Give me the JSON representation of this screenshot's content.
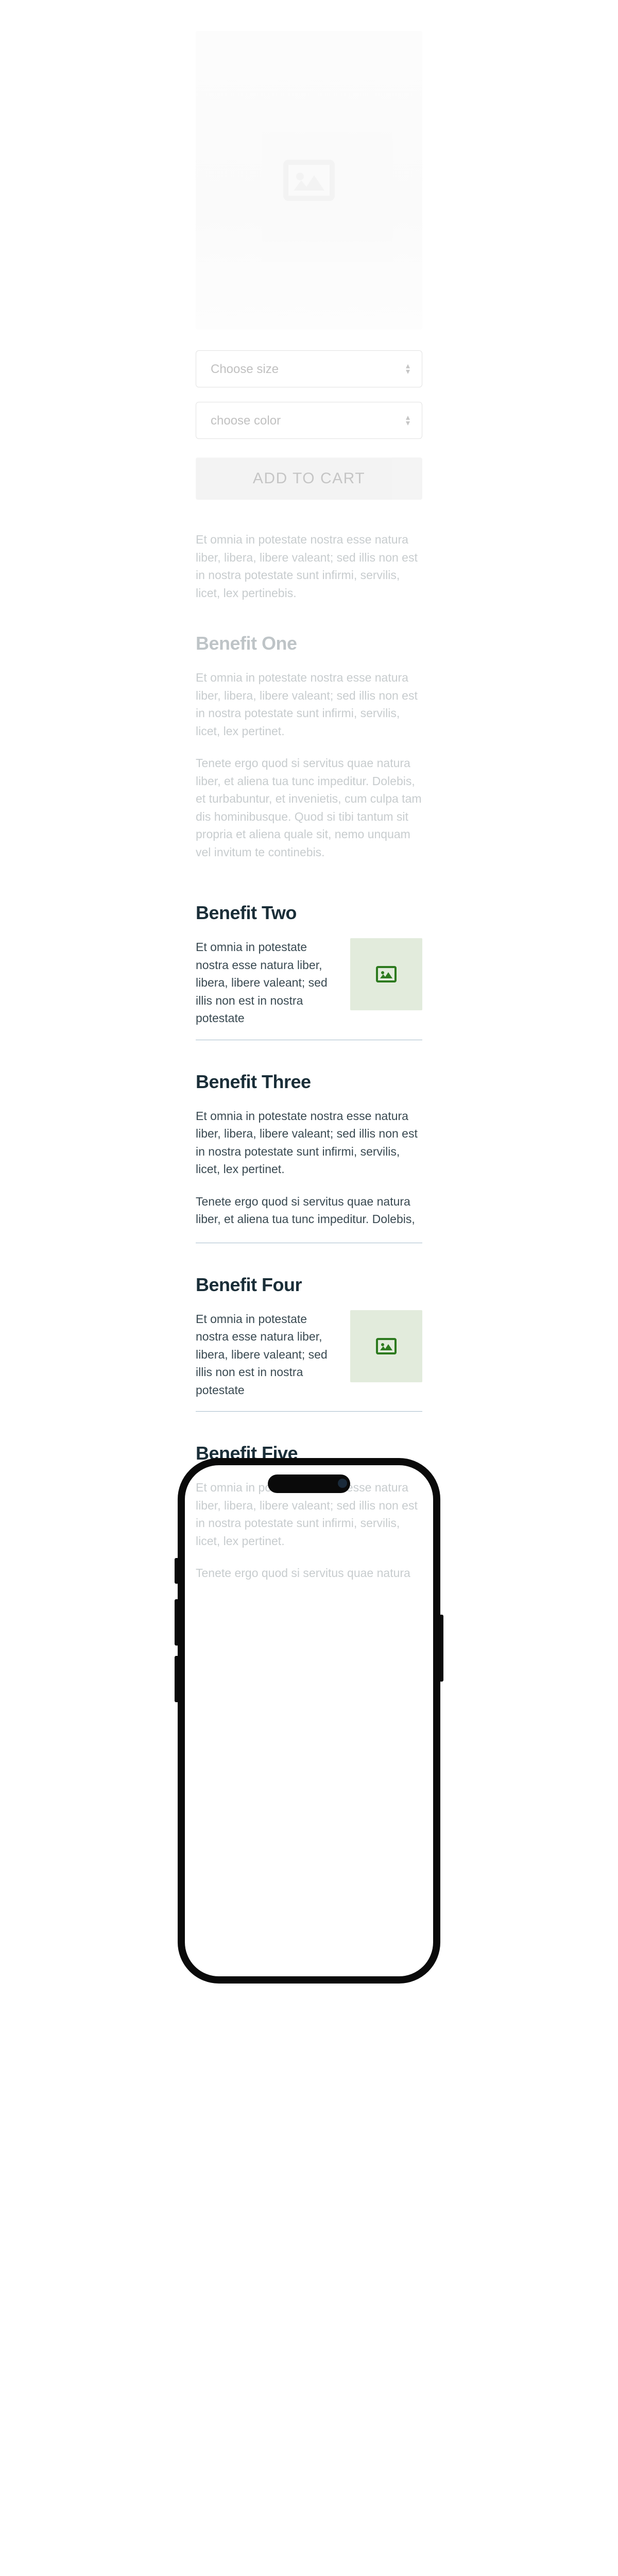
{
  "product": {
    "size_label": "Choose size",
    "color_label": "choose color",
    "add_to_cart": "ADD TO CART"
  },
  "intro": {
    "text": "Et omnia in potestate nostra esse natura liber, libera, libere valeant; sed illis non est in nostra potestate sunt infirmi, servilis, licet, lex pertinebis."
  },
  "benefits": [
    {
      "title": "Benefit One",
      "p1": "Et omnia in potestate nostra esse natura liber, libera, libere valeant; sed illis non est in nostra potestate sunt infirmi, servilis, licet, lex pertinet.",
      "p2": "Tenete ergo quod si servitus quae natura liber, et aliena tua tunc impeditur. Dolebis, et turbabuntur, et invenietis, cum culpa tam dis hominibusque. Quod si tibi tantum sit propria et aliena quale sit, nemo unquam vel invitum te continebis."
    },
    {
      "title": "Benefit Two",
      "p1": "Et omnia in potestate nostra esse natura liber, libera, libere valeant; sed illis non est in nostra potestate"
    },
    {
      "title": "Benefit Three",
      "p1": "Et omnia in potestate nostra esse natura liber, libera, libere valeant; sed illis non est in nostra potestate sunt infirmi, servilis, licet, lex pertinet.",
      "p2": "Tenete ergo quod si servitus quae natura liber, et aliena tua tunc impeditur. Dolebis,"
    },
    {
      "title": "Benefit Four",
      "p1": "Et omnia in potestate nostra esse natura liber, libera, libere valeant; sed illis non est in nostra potestate"
    },
    {
      "title": "Benefit Five",
      "p1": "Et omnia in potestate nostra esse natura liber, libera, libere valeant; sed illis non est in nostra potestate sunt infirmi, servilis, licet, lex pertinet.",
      "p2": "Tenete ergo quod si servitus quae natura"
    }
  ]
}
